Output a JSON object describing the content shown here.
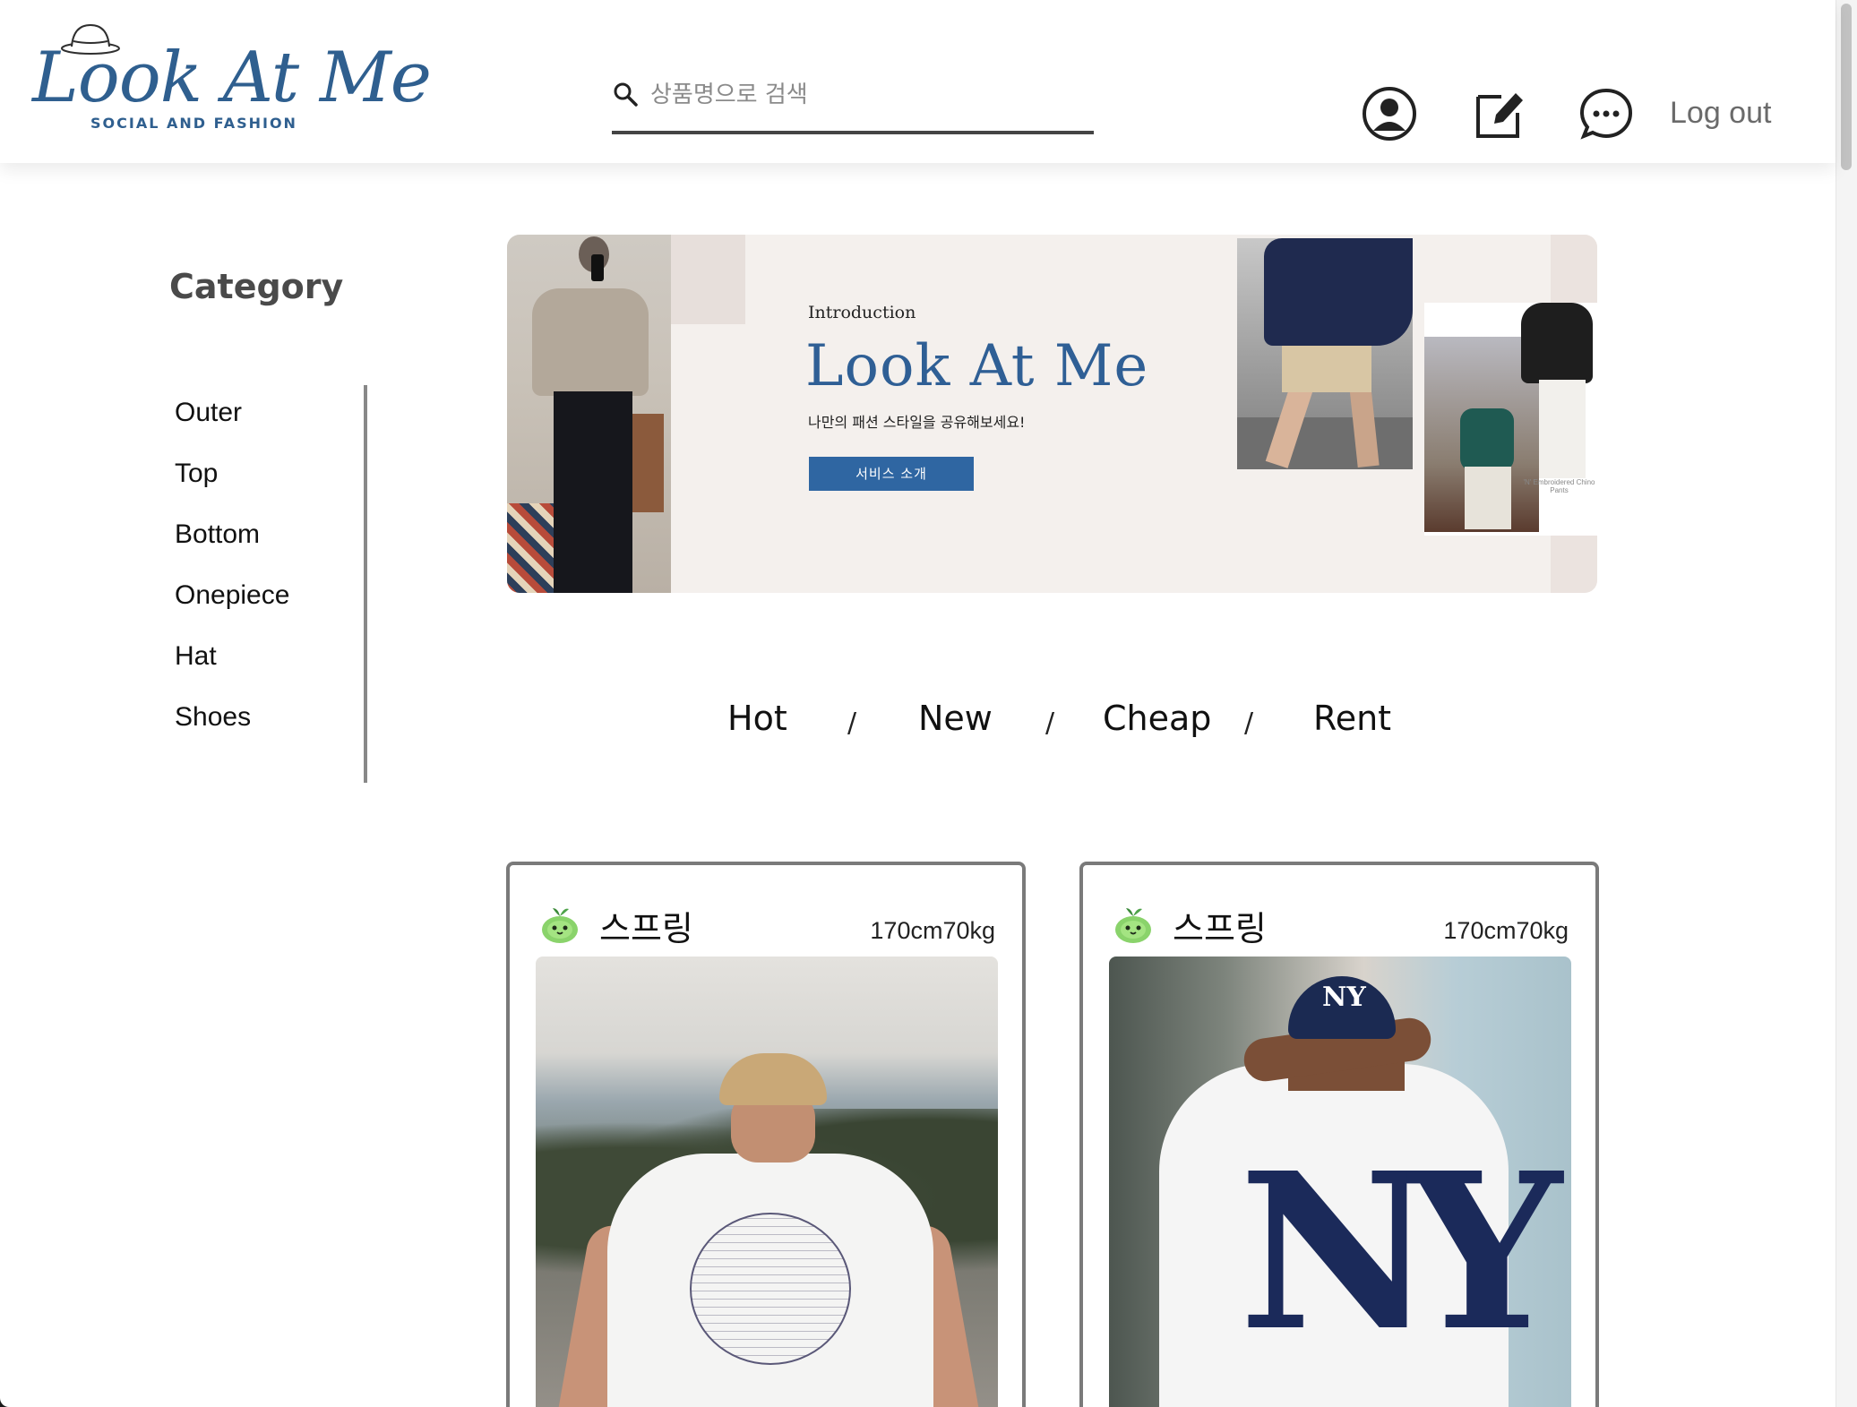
{
  "header": {
    "logo_script": "Look At Me",
    "logo_tagline": "SOCIAL AND FASHION",
    "search_placeholder": "상품명으로 검색",
    "icons": [
      "profile-icon",
      "edit-icon",
      "chat-icon"
    ],
    "logout_label": "Log out"
  },
  "sidebar": {
    "title": "Category",
    "items": [
      "Outer",
      "Top",
      "Bottom",
      "Onepiece",
      "Hat",
      "Shoes"
    ]
  },
  "banner": {
    "intro": "Introduction",
    "title": "Look At Me",
    "subtitle": "나만의 패션 스타일을 공유해보세요!",
    "button_label": "서비스 소개",
    "photo_caption": "'N' Embroidered Chino Pants"
  },
  "tabs": {
    "items": [
      "Hot",
      "New",
      "Cheap",
      "Rent"
    ],
    "separator": "/"
  },
  "cards": [
    {
      "user": "스프링",
      "size": "170cm70kg"
    },
    {
      "user": "스프링",
      "size": "170cm70kg"
    }
  ],
  "colors": {
    "brand": "#2f5f8f",
    "banner_bg": "#f4f0ed",
    "button": "#2f66a2"
  }
}
